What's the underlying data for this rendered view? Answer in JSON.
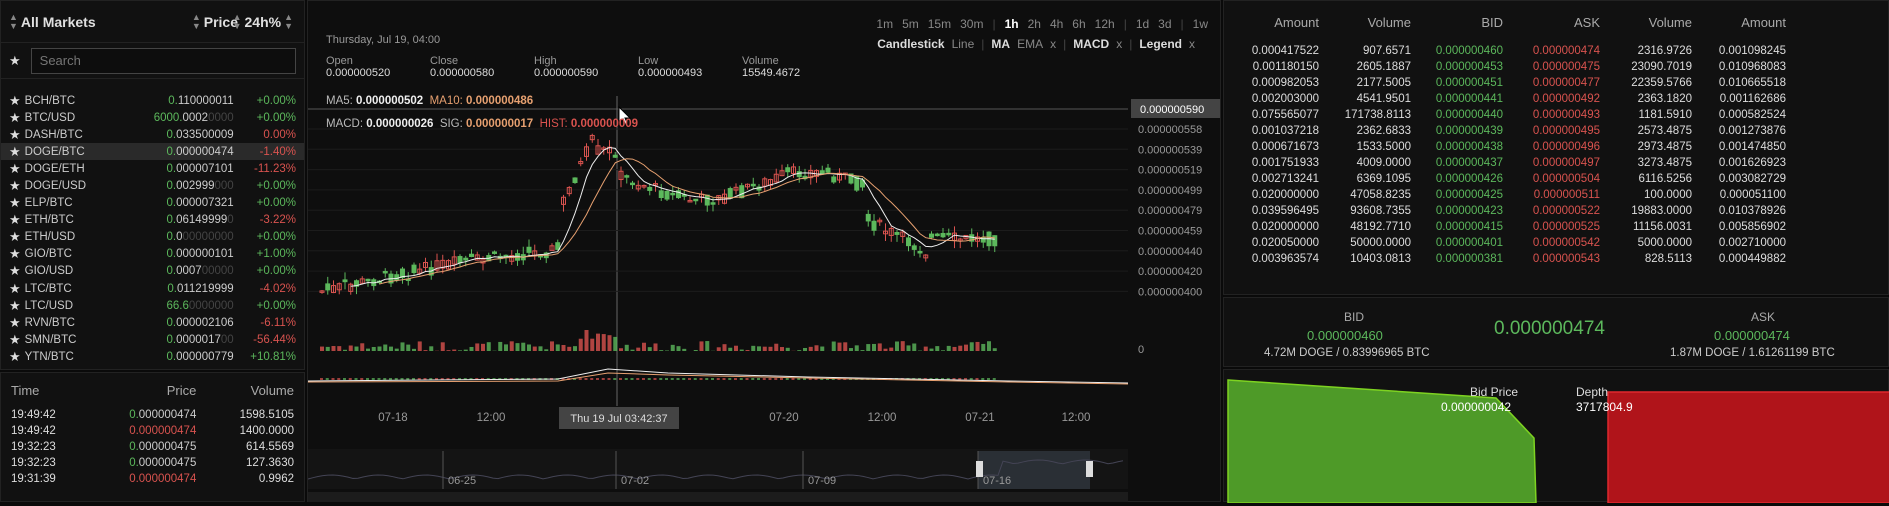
{
  "markets": {
    "title": "All Markets",
    "price_col": "Price",
    "change_col": "24h",
    "change_suffix": "%",
    "search_placeholder": "Search",
    "rows": [
      {
        "pair": "BCH/BTC",
        "p_lead": "0.",
        "p_mid": "110000011",
        "p_tail": "",
        "p_color": "g",
        "change": "+0.00%",
        "c_color": "g"
      },
      {
        "pair": "BTC/USD",
        "p_lead": "6000.",
        "p_mid": "0002",
        "p_tail": "0000",
        "p_color": "g",
        "change": "+0.00%",
        "c_color": "g"
      },
      {
        "pair": "DASH/BTC",
        "p_lead": "0.",
        "p_mid": "033500009",
        "p_tail": "",
        "p_color": "g",
        "change": "0.00%",
        "c_color": "r"
      },
      {
        "pair": "DOGE/BTC",
        "p_lead": "0.",
        "p_mid": "000000474",
        "p_tail": "",
        "p_color": "g",
        "change": "-1.40%",
        "c_color": "r",
        "selected": true
      },
      {
        "pair": "DOGE/ETH",
        "p_lead": "0.",
        "p_mid": "000007101",
        "p_tail": "",
        "p_color": "g",
        "change": "-11.23%",
        "c_color": "r"
      },
      {
        "pair": "DOGE/USD",
        "p_lead": "0.",
        "p_mid": "002999",
        "p_tail": "000",
        "p_color": "g",
        "change": "+0.00%",
        "c_color": "g"
      },
      {
        "pair": "ELP/BTC",
        "p_lead": "0.",
        "p_mid": "000007321",
        "p_tail": "",
        "p_color": "g",
        "change": "+0.00%",
        "c_color": "g"
      },
      {
        "pair": "ETH/BTC",
        "p_lead": "0.",
        "p_mid": "06149999",
        "p_tail": "0",
        "p_color": "g",
        "change": "-3.22%",
        "c_color": "r"
      },
      {
        "pair": "ETH/USD",
        "p_lead": "0.",
        "p_mid": "0",
        "p_tail": "00000000",
        "p_color": "g",
        "change": "+0.00%",
        "c_color": "g"
      },
      {
        "pair": "GIO/BTC",
        "p_lead": "0.",
        "p_mid": "000000101",
        "p_tail": "",
        "p_color": "g",
        "change": "+1.00%",
        "c_color": "g"
      },
      {
        "pair": "GIO/USD",
        "p_lead": "0.",
        "p_mid": "0007",
        "p_tail": "00000",
        "p_color": "g",
        "change": "+0.00%",
        "c_color": "g"
      },
      {
        "pair": "LTC/BTC",
        "p_lead": "0.",
        "p_mid": "011219999",
        "p_tail": "",
        "p_color": "g",
        "change": "-4.02%",
        "c_color": "r"
      },
      {
        "pair": "LTC/USD",
        "p_lead": "66.6",
        "p_mid": "",
        "p_tail": "0000000",
        "p_color": "g",
        "change": "+0.00%",
        "c_color": "g"
      },
      {
        "pair": "RVN/BTC",
        "p_lead": "0.",
        "p_mid": "000002106",
        "p_tail": "",
        "p_color": "g",
        "change": "-6.11%",
        "c_color": "r"
      },
      {
        "pair": "SMN/BTC",
        "p_lead": "0.",
        "p_mid": "0000017",
        "p_tail": "00",
        "p_color": "g",
        "change": "-56.44%",
        "c_color": "r"
      },
      {
        "pair": "YTN/BTC",
        "p_lead": "0.",
        "p_mid": "000000779",
        "p_tail": "",
        "p_color": "g",
        "change": "+10.81%",
        "c_color": "g"
      }
    ]
  },
  "trades": {
    "time_col": "Time",
    "price_col": "Price",
    "volume_col": "Volume",
    "rows": [
      {
        "time": "19:49:42",
        "p_lead": "0.",
        "p_rest": "000000474",
        "color": "g",
        "vol_int": "1598.",
        "vol_dec": "5105"
      },
      {
        "time": "19:49:42",
        "p_lead": "0.",
        "p_rest": "000000474",
        "color": "r",
        "vol_int": "1400.",
        "vol_dec": "0000"
      },
      {
        "time": "19:32:23",
        "p_lead": "0.",
        "p_rest": "000000475",
        "color": "g",
        "vol_int": "614.",
        "vol_dec": "5569"
      },
      {
        "time": "19:32:23",
        "p_lead": "0.",
        "p_rest": "000000475",
        "color": "g",
        "vol_int": "127.",
        "vol_dec": "3630"
      },
      {
        "time": "19:31:39",
        "p_lead": "0.",
        "p_rest": "000000474",
        "color": "r",
        "vol_int": "0.",
        "vol_dec": "9962"
      }
    ]
  },
  "chart": {
    "timeframes": [
      "1m",
      "5m",
      "15m",
      "30m",
      "1h",
      "2h",
      "4h",
      "6h",
      "12h",
      "1d",
      "3d",
      "1w"
    ],
    "active_timeframe": "1h",
    "options": {
      "candlestick": "Candlestick",
      "line": "Line",
      "ma": "MA",
      "ema": "EMA",
      "macd": "MACD",
      "legend": "Legend",
      "x": "x"
    },
    "date": "Thursday, Jul 19, 04:00",
    "ohlc_labels": [
      "Open",
      "Close",
      "High",
      "Low",
      "Volume"
    ],
    "ohlc_values": [
      "0.000000520",
      "0.000000580",
      "0.000000590",
      "0.000000493",
      "15549.4672"
    ],
    "ma5_label": "MA5:",
    "ma5": "0.000000502",
    "ma10_label": "MA10:",
    "ma10": "0.000000486",
    "macd_label": "MACD:",
    "macd": "0.000000026",
    "sig_label": "SIG:",
    "sig": "0.000000017",
    "hist_label": "HIST:",
    "hist": "0.000000009",
    "crosshair_price": "0.000000590",
    "y_ticks": [
      "0.000000558",
      "0.000000539",
      "0.000000519",
      "0.000000499",
      "0.000000479",
      "0.000000459",
      "0.000000440",
      "0.000000420",
      "0.000000400"
    ],
    "vol_zero": "0",
    "x_ticks": [
      "07-18",
      "12:00",
      "07-19",
      "07-20",
      "12:00",
      "07-21",
      "12:00"
    ],
    "crosshair_time": "Thu 19 Jul 03:42:37",
    "nav_ticks": [
      "06-25",
      "07-02",
      "07-09",
      "07-16"
    ],
    "colors": {
      "up": "#5cb85c",
      "down": "#d9534f",
      "ma5": "#eeeeee",
      "ma10": "#e6a070"
    }
  },
  "orderbook": {
    "headers": [
      "Amount",
      "Volume",
      "BID",
      "ASK",
      "Volume",
      "Amount"
    ],
    "rows": [
      [
        "0.000417522",
        "907.6571",
        "0.000000460",
        "0.000000474",
        "2316.9726",
        "0.001098245"
      ],
      [
        "0.001180150",
        "2605.1887",
        "0.000000453",
        "0.000000475",
        "23090.7019",
        "0.010968083"
      ],
      [
        "0.000982053",
        "2177.5005",
        "0.000000451",
        "0.000000477",
        "22359.5766",
        "0.010665518"
      ],
      [
        "0.002003000",
        "4541.9501",
        "0.000000441",
        "0.000000492",
        "2363.1820",
        "0.001162686"
      ],
      [
        "0.075565077",
        "171738.8113",
        "0.000000440",
        "0.000000493",
        "1181.5910",
        "0.000582524"
      ],
      [
        "0.001037218",
        "2362.6833",
        "0.000000439",
        "0.000000495",
        "2573.4875",
        "0.001273876"
      ],
      [
        "0.000671673",
        "1533.5000",
        "0.000000438",
        "0.000000496",
        "2973.4875",
        "0.001474850"
      ],
      [
        "0.001751933",
        "4009.0000",
        "0.000000437",
        "0.000000497",
        "3273.4875",
        "0.001626923"
      ],
      [
        "0.002713241",
        "6369.1095",
        "0.000000426",
        "0.000000504",
        "6116.5256",
        "0.003082729"
      ],
      [
        "0.020000000",
        "47058.8235",
        "0.000000425",
        "0.000000511",
        "100.0000",
        "0.000051100"
      ],
      [
        "0.039596495",
        "93608.7355",
        "0.000000423",
        "0.000000522",
        "19883.0000",
        "0.010378926"
      ],
      [
        "0.020000000",
        "48192.7710",
        "0.000000415",
        "0.000000525",
        "11156.0031",
        "0.005856902"
      ],
      [
        "0.020050000",
        "50000.0000",
        "0.000000401",
        "0.000000542",
        "5000.0000",
        "0.002710000"
      ],
      [
        "0.003963574",
        "10403.0813",
        "0.000000381",
        "0.000000543",
        "828.5113",
        "0.000449882"
      ]
    ]
  },
  "ticker": {
    "bid_label": "BID",
    "bid": "0.000000460",
    "last": "0.000000474",
    "ask_label": "ASK",
    "ask": "0.000000474",
    "bid_vol": "4.72M",
    "bid_unit": "DOGE",
    "bid_btc": "0.83996965",
    "ask_vol": "1.87M",
    "ask_unit": "DOGE",
    "ask_btc": "1.61261199",
    "btc": "BTC"
  },
  "depth": {
    "bid_price_label": "Bid Price",
    "depth_label": "Depth",
    "bid_price": "0.000000042",
    "depth": "3717804.9"
  }
}
